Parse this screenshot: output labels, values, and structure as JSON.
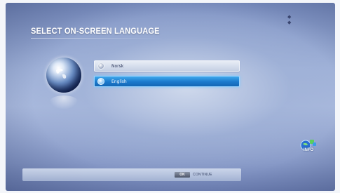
{
  "screen": {
    "title": "SELECT ON-SCREEN LANGUAGE"
  },
  "languages": [
    {
      "label": "Norsk",
      "selected": false
    },
    {
      "label": "English",
      "selected": true
    }
  ],
  "info_badge": {
    "label": "INFO",
    "icon": "globe-icon"
  },
  "footer": {
    "ok_key": "OK",
    "continue_label": "CONTINUE"
  },
  "colors": {
    "background": "#9fb1d8",
    "selected_item": "#1a79cc",
    "unselected_item": "#d6deee",
    "title": "#ffffff"
  }
}
